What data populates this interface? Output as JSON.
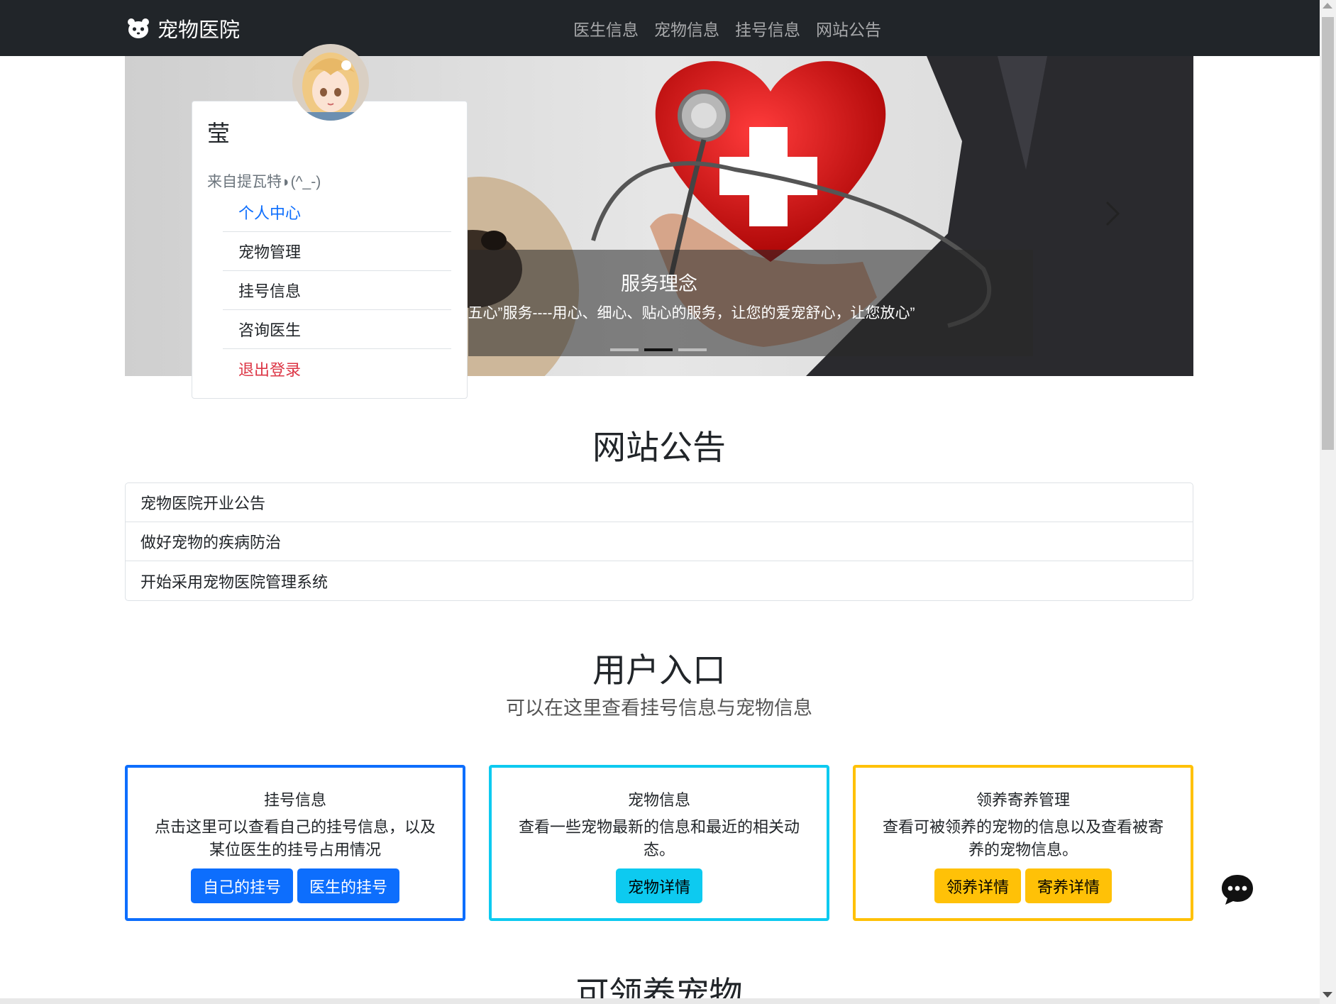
{
  "navbar": {
    "brand": "宠物医院",
    "links": [
      "医生信息",
      "宠物信息",
      "挂号信息",
      "网站公告"
    ]
  },
  "carousel": {
    "caption_title": "服务理念",
    "caption_text": "服务永远“五心”服务----用心、细心、贴心的服务，让您的爱宠舒心，让您放心”",
    "active_slide": 2,
    "slide_count": 3
  },
  "profile": {
    "name": "莹",
    "subtitle": "来自提瓦特◗(^_-)",
    "menu": [
      "个人中心",
      "宠物管理",
      "挂号信息",
      "咨询医生",
      "退出登录"
    ]
  },
  "announcements": {
    "title": "网站公告",
    "items": [
      "宠物医院开业公告",
      "做好宠物的疾病防治",
      "开始采用宠物医院管理系统"
    ]
  },
  "user_entry": {
    "title": "用户入口",
    "subtitle": "可以在这里查看挂号信息与宠物信息",
    "cards": [
      {
        "title": "挂号信息",
        "text": "点击这里可以查看自己的挂号信息，以及某位医生的挂号占用情况",
        "buttons": [
          "自己的挂号",
          "医生的挂号"
        ],
        "color": "#0d6efd"
      },
      {
        "title": "宠物信息",
        "text": "查看一些宠物最新的信息和最近的相关动态。",
        "buttons": [
          "宠物详情"
        ],
        "color": "#0dcaf0"
      },
      {
        "title": "领养寄养管理",
        "text": "查看可被领养的宠物的信息以及查看被寄养的宠物信息。",
        "buttons": [
          "领养详情",
          "寄养详情"
        ],
        "color": "#ffc107"
      }
    ]
  },
  "adopt_section": {
    "title": "可领养宠物"
  },
  "icons": [
    "panda-logo-icon",
    "chevron-right-icon",
    "chat-bubble-icon"
  ]
}
